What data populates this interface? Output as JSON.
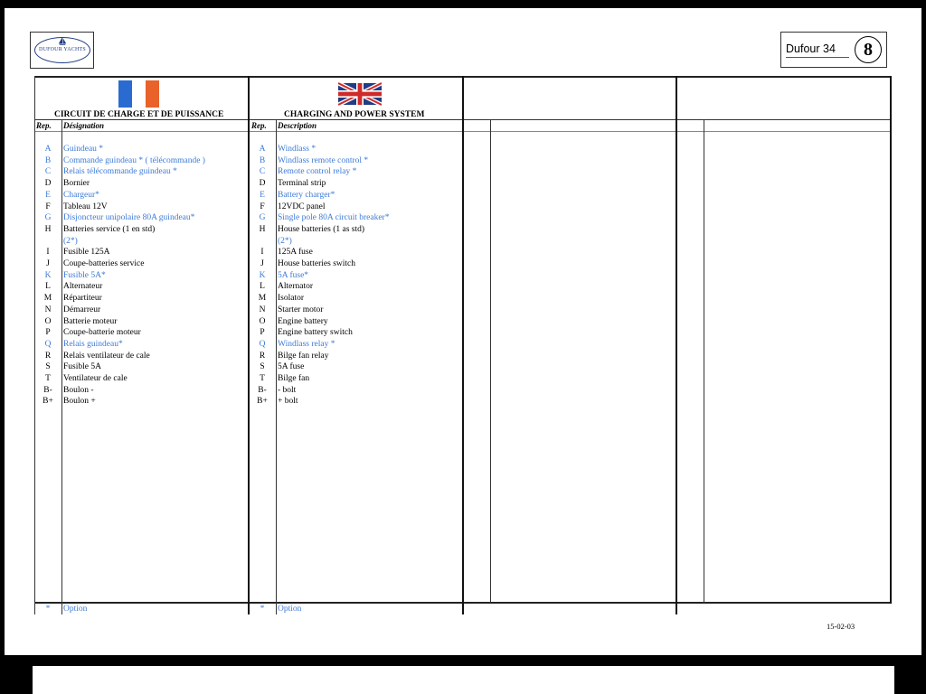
{
  "header": {
    "logo_text": "DUFOUR YACHTS",
    "doc_title": "Dufour 34",
    "page_number": "8"
  },
  "sections": {
    "fr": {
      "title": "CIRCUIT DE CHARGE ET DE PUISSANCE",
      "rep_header": "Rep.",
      "desc_header": "Désignation"
    },
    "en": {
      "title": "CHARGING AND POWER SYSTEM",
      "rep_header": "Rep.",
      "desc_header": "Description"
    }
  },
  "rows": [
    {
      "rep": "A",
      "fr": "Guindeau *",
      "en": "Windlass *",
      "option": true
    },
    {
      "rep": "B",
      "fr": "Commande guindeau * ( télécommande )",
      "en": "Windlass remote control *",
      "option": true
    },
    {
      "rep": "C",
      "fr": "Relais télécommande guindeau *",
      "en": "Remote control relay *",
      "option": true
    },
    {
      "rep": "D",
      "fr": "Bornier",
      "en": "Terminal strip",
      "option": false
    },
    {
      "rep": "E",
      "fr": "Chargeur*",
      "en": "Battery charger*",
      "option": true
    },
    {
      "rep": "F",
      "fr": "Tableau 12V",
      "en": "12VDC panel",
      "option": false
    },
    {
      "rep": "G",
      "fr": "Disjoncteur unipolaire 80A guindeau*",
      "en": "Single pole 80A circuit breaker*",
      "option": true
    },
    {
      "rep": "H",
      "fr": "Batteries service (1 en std)",
      "en": "House batteries (1 as std)",
      "option": false
    },
    {
      "rep": "",
      "fr": "(2*)",
      "en": "(2*)",
      "option": true
    },
    {
      "rep": "I",
      "fr": "Fusible 125A",
      "en": "125A fuse",
      "option": false
    },
    {
      "rep": "J",
      "fr": "Coupe-batteries service",
      "en": "House batteries switch",
      "option": false
    },
    {
      "rep": "K",
      "fr": "Fusible 5A*",
      "en": "5A fuse*",
      "option": true
    },
    {
      "rep": "L",
      "fr": "Alternateur",
      "en": "Alternator",
      "option": false
    },
    {
      "rep": "M",
      "fr": "Répartiteur",
      "en": "Isolator",
      "option": false
    },
    {
      "rep": "N",
      "fr": "Démarreur",
      "en": "Starter motor",
      "option": false
    },
    {
      "rep": "O",
      "fr": "Batterie moteur",
      "en": "Engine battery",
      "option": false
    },
    {
      "rep": "P",
      "fr": "Coupe-batterie moteur",
      "en": "Engine battery switch",
      "option": false
    },
    {
      "rep": "Q",
      "fr": "Relais guindeau*",
      "en": "Windlass relay *",
      "option": true
    },
    {
      "rep": "R",
      "fr": "Relais ventilateur de cale",
      "en": "Bilge fan relay",
      "option": false
    },
    {
      "rep": "S",
      "fr": "Fusible 5A",
      "en": "5A fuse",
      "option": false
    },
    {
      "rep": "T",
      "fr": "Ventilateur de cale",
      "en": "Bilge fan",
      "option": false
    },
    {
      "rep": "B-",
      "fr": "Boulon -",
      "en": "- bolt",
      "option": false
    },
    {
      "rep": "B+",
      "fr": "Boulon +",
      "en": "+ bolt",
      "option": false
    }
  ],
  "footer": {
    "fr": {
      "rep": "*",
      "label": "Option"
    },
    "en": {
      "rep": "*",
      "label": "Option"
    },
    "date": "15-02-03"
  },
  "colors": {
    "option_text": "#3d7bd6",
    "normal_text": "#000000",
    "flag_fr_blue": "#2a6bd1",
    "flag_fr_red": "#e8622a"
  },
  "icons": {
    "fr_flag": "french-flag-icon",
    "uk_flag": "uk-flag-icon",
    "logo": "dufour-yachts-logo"
  }
}
